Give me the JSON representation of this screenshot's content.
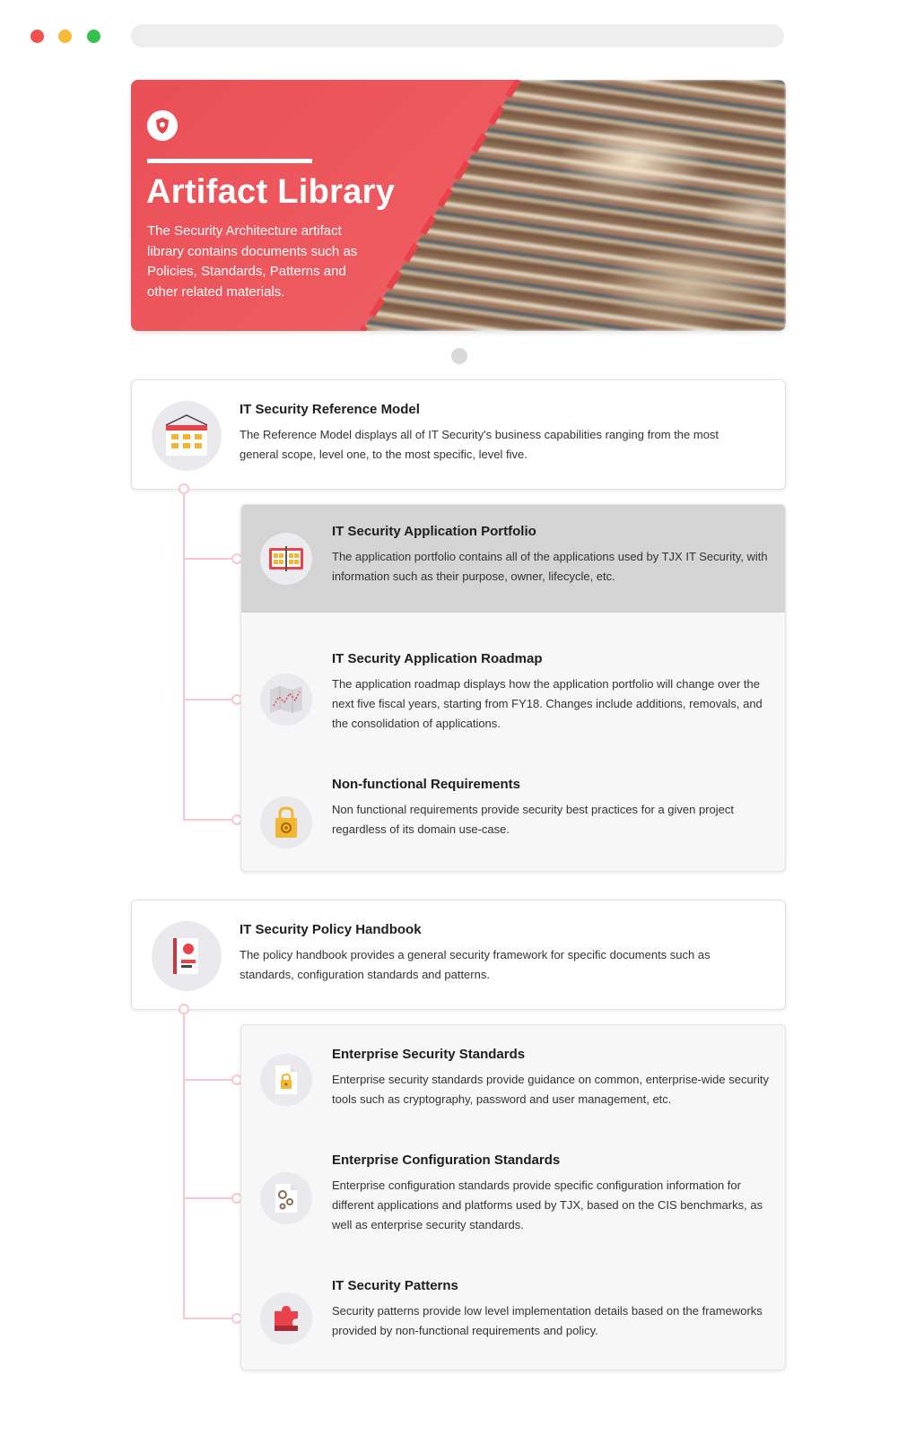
{
  "colors": {
    "accent": "#ea4f56",
    "connector": "#f6c8cb",
    "selected_bg": "#d4d4d4"
  },
  "hero": {
    "title": "Artifact Library",
    "description": "The Security Architecture artifact library contains documents such as Policies, Standards, Patterns and other related materials.",
    "logo_icon": "shield-logo-icon"
  },
  "sections": [
    {
      "title": "IT Security Reference Model",
      "description": "The Reference Model displays all of IT Security's business capabilities ranging from the most general scope, level one, to the most specific, level five.",
      "icon": "building-grid-icon",
      "children": [
        {
          "title": "IT Security Application Portfolio",
          "description": "The application portfolio contains all of the applications used by TJX IT Security, with information such as their purpose, owner, lifecycle, etc.",
          "icon": "portfolio-book-icon",
          "selected": true
        },
        {
          "title": "IT Security Application Roadmap",
          "description": "The application roadmap displays how the application portfolio will change over the next five fiscal years, starting from FY18. Changes include additions, removals, and the consolidation of applications.",
          "icon": "roadmap-map-icon"
        },
        {
          "title": "Non-functional Requirements",
          "description": "Non functional requirements provide security best practices for a given project regardless of its domain use-case.",
          "icon": "lock-gear-icon"
        }
      ]
    },
    {
      "title": "IT Security Policy Handbook",
      "description": "The policy handbook provides a general security framework for specific documents such as standards, configuration standards and patterns.",
      "icon": "handbook-icon",
      "children": [
        {
          "title": "Enterprise Security Standards",
          "description": "Enterprise security standards provide guidance on common, enterprise-wide security tools such as cryptography, password and user management, etc.",
          "icon": "document-lock-icon"
        },
        {
          "title": "Enterprise Configuration Standards",
          "description": "Enterprise configuration standards provide specific configuration information for different applications and platforms used by TJX, based on the CIS benchmarks, as well as enterprise security standards.",
          "icon": "document-gears-icon"
        },
        {
          "title": "IT Security Patterns",
          "description": "Security patterns provide low level implementation details based on the frameworks provided by non-functional requirements and policy.",
          "icon": "puzzle-piece-icon"
        }
      ]
    }
  ]
}
